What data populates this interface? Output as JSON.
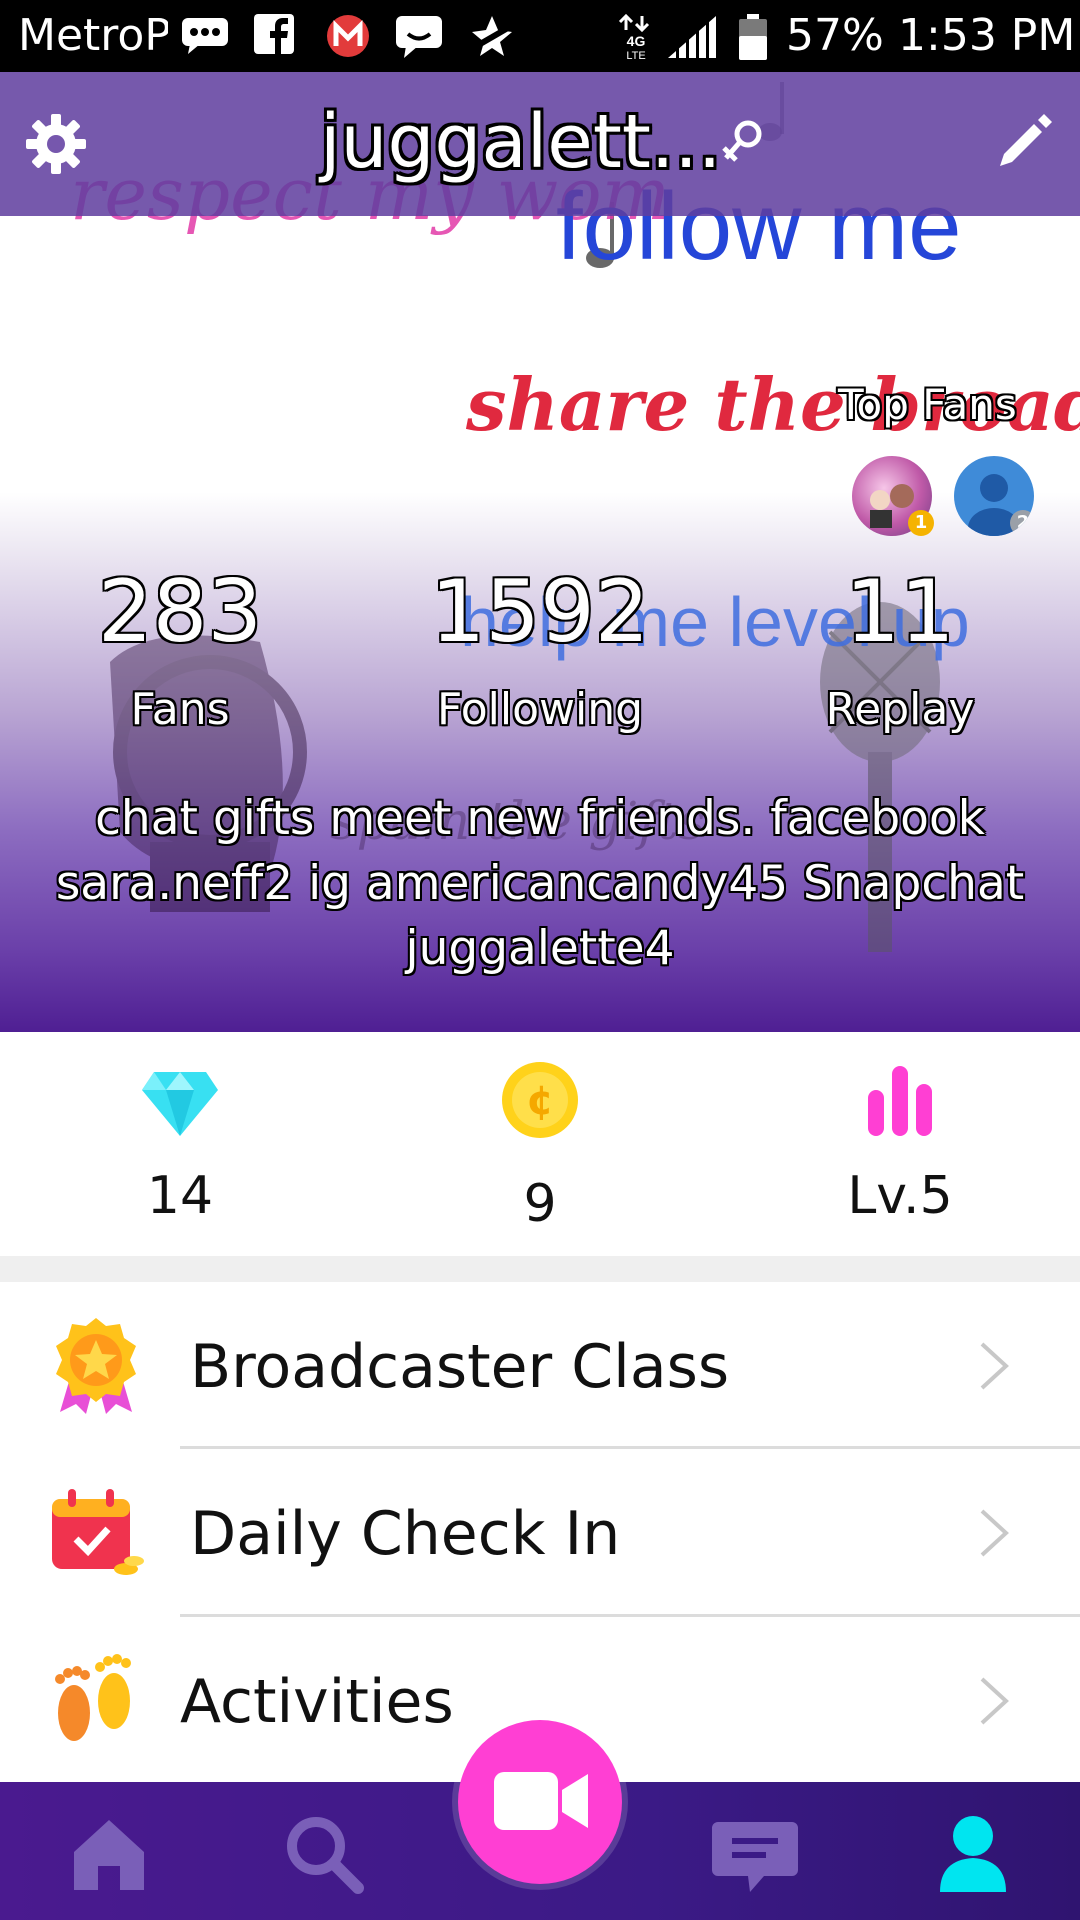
{
  "status_bar": {
    "carrier": "MetroPCS",
    "network": "4G LTE",
    "battery": "57%",
    "time": "1:53 PM"
  },
  "header": {
    "username": "juggalett..."
  },
  "background_text": {
    "line1": "respect my wom",
    "line2": "follow me",
    "line3": "share the broadcast",
    "line4": "help me level up",
    "line5": "spam the gifts"
  },
  "top_fans": {
    "label": "Top Fans",
    "ranks": [
      "1",
      "2"
    ]
  },
  "stats": [
    {
      "value": "283",
      "label": "Fans"
    },
    {
      "value": "1592",
      "label": "Following"
    },
    {
      "value": "11",
      "label": "Replay"
    }
  ],
  "bio": "chat gifts meet new friends. facebook sara.neff2 ig americancandy45  Snapchat juggalette4",
  "wallet": {
    "diamonds": "14",
    "coins": "9",
    "level": "Lv.5",
    "coin_symbol": "¢"
  },
  "menu": [
    {
      "label": "Broadcaster Class",
      "icon": "medal-icon"
    },
    {
      "label": "Daily Check In",
      "icon": "calendar-check-icon"
    },
    {
      "label": "Activities",
      "icon": "footprints-icon"
    }
  ],
  "nav": {
    "items": [
      "home-icon",
      "search-icon",
      "record-video-icon",
      "messages-icon",
      "profile-icon"
    ],
    "active": "profile-icon"
  },
  "colors": {
    "header_purple": "#603e9e",
    "accent_pink": "#ff3fd3",
    "nav_purple": "#3b1a86",
    "active_cyan": "#00e5f0",
    "inactive_nav": "#7a5fb8",
    "diamond": "#38e0f2",
    "coin": "#ffd21a",
    "level_bars": "#ff3fd3"
  }
}
